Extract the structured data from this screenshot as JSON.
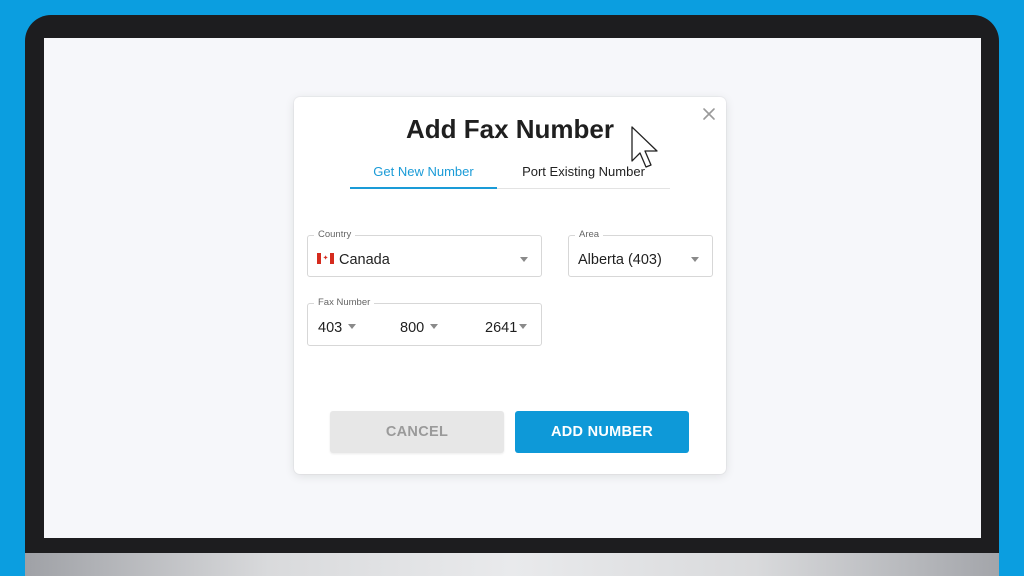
{
  "dialog": {
    "title": "Add Fax Number",
    "tabs": [
      {
        "label": "Get New Number",
        "active": true
      },
      {
        "label": "Port Existing Number",
        "active": false
      }
    ],
    "country": {
      "label": "Country",
      "value": "Canada",
      "flag_icon": "canada-flag-icon"
    },
    "area": {
      "label": "Area",
      "value": "Alberta (403)"
    },
    "fax_number": {
      "label": "Fax Number",
      "parts": [
        "403",
        "800",
        "2641"
      ]
    },
    "buttons": {
      "cancel": "CANCEL",
      "add": "ADD NUMBER"
    }
  },
  "colors": {
    "accent": "#0e99d8",
    "frame": "#0b9ee0",
    "cancel_bg": "#e7e7e7"
  }
}
